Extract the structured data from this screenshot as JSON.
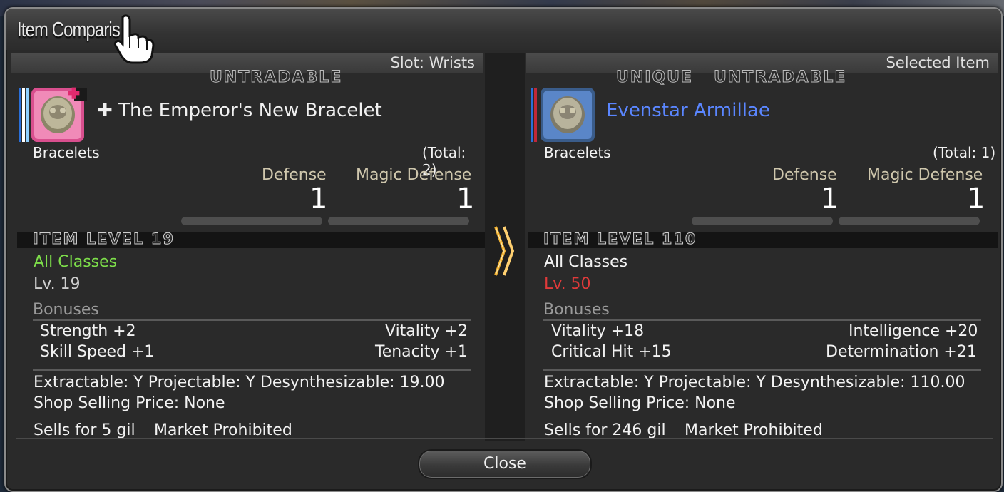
{
  "window": {
    "title": "Item Comparis"
  },
  "left": {
    "slot": "Slot: Wrists",
    "tags": "UNTRADABLE",
    "name_glyph": "✚",
    "name": "The Emperor's New Bracelet",
    "category": "Bracelets",
    "total": "(Total: 2)",
    "defense_label": "Defense",
    "defense": "1",
    "mdef_label": "Magic Defense",
    "mdef": "1",
    "item_level": "ITEM LEVEL 19",
    "classes": "All Classes",
    "level": "Lv. 19",
    "bonuses_header": "Bonuses",
    "bonuses": [
      "Strength +2",
      "Vitality +2",
      "Skill Speed +1",
      "Tenacity +1"
    ],
    "extract_line": "Extractable: Y  Projectable: Y  Desynthesizable: 19.00",
    "shop_line": "Shop Selling Price: None",
    "sells": "Sells for 5 gil",
    "market": "Market Prohibited"
  },
  "right": {
    "slot": "Selected Item",
    "tags": "UNIQUE   UNTRADABLE",
    "name": "Evenstar Armillae",
    "category": "Bracelets",
    "total": "(Total: 1)",
    "defense_label": "Defense",
    "defense": "1",
    "mdef_label": "Magic Defense",
    "mdef": "1",
    "item_level": "ITEM LEVEL 110",
    "classes": "All Classes",
    "level": "Lv. 50",
    "bonuses_header": "Bonuses",
    "bonuses": [
      "Vitality +18",
      "Intelligence +20",
      "Critical Hit +15",
      "Determination +21"
    ],
    "extract_line": "Extractable: Y  Projectable: Y  Desynthesizable: 110.00",
    "shop_line": "Shop Selling Price: None",
    "sells": "Sells for 246 gil",
    "market": "Market Prohibited"
  },
  "footer": {
    "close_label": "Close"
  },
  "colors": {
    "class_ok": "#7dde4a",
    "level_fail": "#e03a3a",
    "name_blue": "#5a86ff"
  },
  "icons": [
    "bracelet-icon-pink",
    "bracelet-icon-blue",
    "double-chevron-icon",
    "hand-pointer-icon"
  ]
}
